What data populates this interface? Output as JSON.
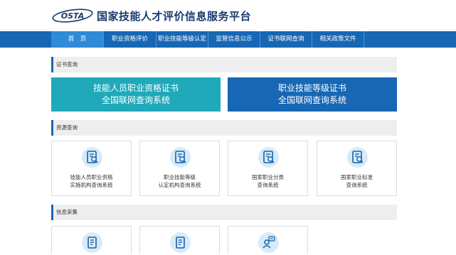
{
  "header": {
    "logo_text": "OSTA",
    "site_title": "国家技能人才评价信息服务平台"
  },
  "nav": {
    "items": [
      {
        "label": "首　页"
      },
      {
        "label": "职业资格评价"
      },
      {
        "label": "职业技能等级认定"
      },
      {
        "label": "监管信息公示"
      },
      {
        "label": "证书联网查询"
      },
      {
        "label": "相关政策文件"
      }
    ]
  },
  "sections": {
    "certificate_query": {
      "title": "证书查询"
    },
    "resource_query": {
      "title": "资源查询"
    },
    "info_collection": {
      "title": "信息采集"
    }
  },
  "certificate_buttons": [
    {
      "line1": "技能人员职业资格证书",
      "line2": "全国联网查询系统"
    },
    {
      "line1": "职业技能等级证书",
      "line2": "全国联网查询系统"
    }
  ],
  "resource_cards": [
    {
      "line1": "技能人员职业资格",
      "line2": "实施机构查询系统",
      "icon": "certificate-search-icon"
    },
    {
      "line1": "职业技能等级",
      "line2": "认定机构查询系统",
      "icon": "certificate-search-icon"
    },
    {
      "line1": "国家职业分类",
      "line2": "查询系统",
      "icon": "certificate-search-icon"
    },
    {
      "line1": "国家职业标准",
      "line2": "查询系统",
      "icon": "certificate-search-icon"
    }
  ],
  "collection_cards": [
    {
      "icon": "document-icon"
    },
    {
      "icon": "document-icon"
    },
    {
      "icon": "user-chat-icon"
    }
  ],
  "colors": {
    "nav_bg": "#1767b5",
    "nav_active": "#2f8ad8",
    "teal": "#1fa9b9",
    "title": "#1a3a6e"
  }
}
